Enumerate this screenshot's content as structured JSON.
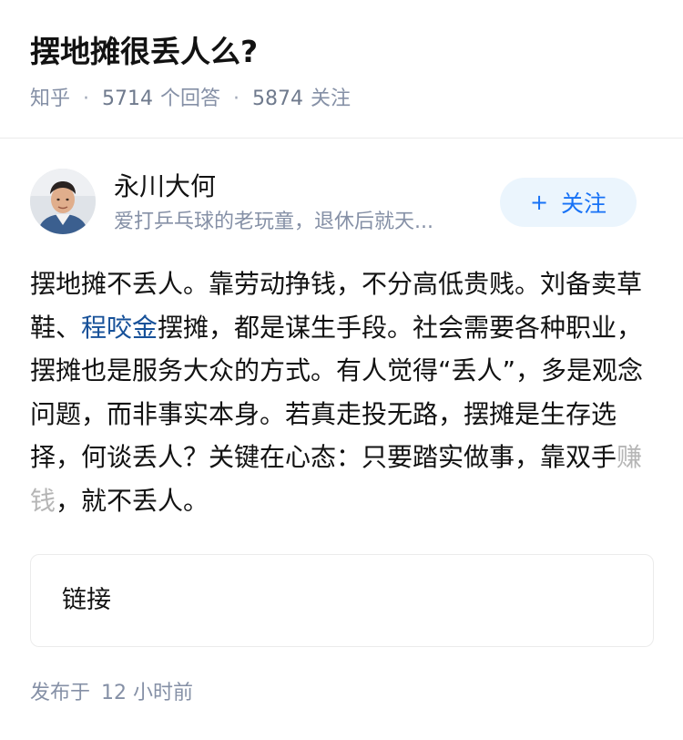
{
  "question": {
    "title": "摆地摊很丢人么?",
    "source": "知乎",
    "answer_count": "5714",
    "answer_label": "个回答",
    "follow_count": "5874",
    "follow_label": "关注"
  },
  "author": {
    "name": "永川大何",
    "bio": "爱打乒乓球的老玩童，退休后就天...",
    "follow_button": "关注",
    "follow_plus": "+"
  },
  "answer": {
    "segments": {
      "s1": "摆地摊不丢人。靠劳动挣钱，不分高低贵贱。刘备卖草鞋、",
      "link": "程咬金",
      "s2": "摆摊，都是谋生手段。社会需要各种职业，摆摊也是服务大众的方式。有人觉得“丢人”，多是观念问题，而非事实本身。若真走投无路，摆摊是生存选择，何谈丢人？关键在心态：只要踏实做事，靠双手",
      "blurred": "赚钱",
      "s3": "，就不丢人。"
    }
  },
  "link_card": {
    "label": "链接"
  },
  "publish": {
    "prefix": "发布于",
    "time": "12 小时前"
  }
}
